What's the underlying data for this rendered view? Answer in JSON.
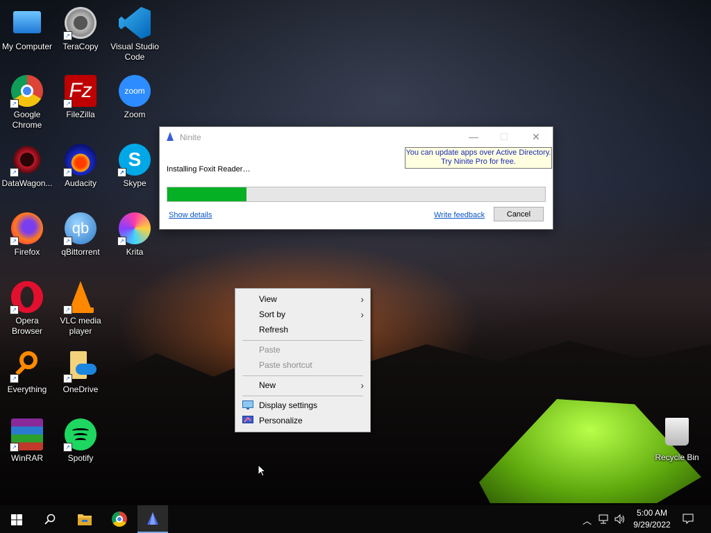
{
  "desktop": {
    "icons": [
      {
        "label": "My Computer",
        "icon": "computer-icon"
      },
      {
        "label": "TeraCopy",
        "icon": "teracopy-icon"
      },
      {
        "label": "Visual Studio Code",
        "icon": "vscode-icon"
      },
      {
        "label": "Google Chrome",
        "icon": "chrome-icon"
      },
      {
        "label": "FileZilla",
        "icon": "filezilla-icon"
      },
      {
        "label": "Zoom",
        "icon": "zoom-icon"
      },
      {
        "label": "DataWagon...",
        "icon": "datawagon-icon"
      },
      {
        "label": "Audacity",
        "icon": "audacity-icon"
      },
      {
        "label": "Skype",
        "icon": "skype-icon"
      },
      {
        "label": "Firefox",
        "icon": "firefox-icon"
      },
      {
        "label": "qBittorrent",
        "icon": "qbittorrent-icon"
      },
      {
        "label": "Krita",
        "icon": "krita-icon"
      },
      {
        "label": "Opera Browser",
        "icon": "opera-icon"
      },
      {
        "label": "VLC media player",
        "icon": "vlc-icon"
      },
      {
        "label": "Everything",
        "icon": "everything-icon"
      },
      {
        "label": "OneDrive",
        "icon": "onedrive-icon"
      },
      {
        "label": "WinRAR",
        "icon": "winrar-icon"
      },
      {
        "label": "Spotify",
        "icon": "spotify-icon"
      }
    ],
    "recycle_bin": "Recycle Bin"
  },
  "ninite": {
    "title": "Ninite",
    "ad_line1": "You can update apps over Active Directory.",
    "ad_line2": "Try Ninite Pro for free.",
    "status": "Installing Foxit Reader…",
    "progress": 0.21,
    "show_details": "Show details",
    "write_feedback": "Write feedback",
    "cancel": "Cancel",
    "minimize": "—",
    "maximize": "☐",
    "close": "✕"
  },
  "context_menu": {
    "view": "View",
    "sort_by": "Sort by",
    "refresh": "Refresh",
    "paste": "Paste",
    "paste_shortcut": "Paste shortcut",
    "new": "New",
    "display_settings": "Display settings",
    "personalize": "Personalize"
  },
  "taskbar": {
    "time": "5:00 AM",
    "date": "9/29/2022"
  },
  "colors": {
    "progress_green": "#06b025",
    "link_blue": "#0a55c7",
    "ad_background": "#ffffe1"
  }
}
